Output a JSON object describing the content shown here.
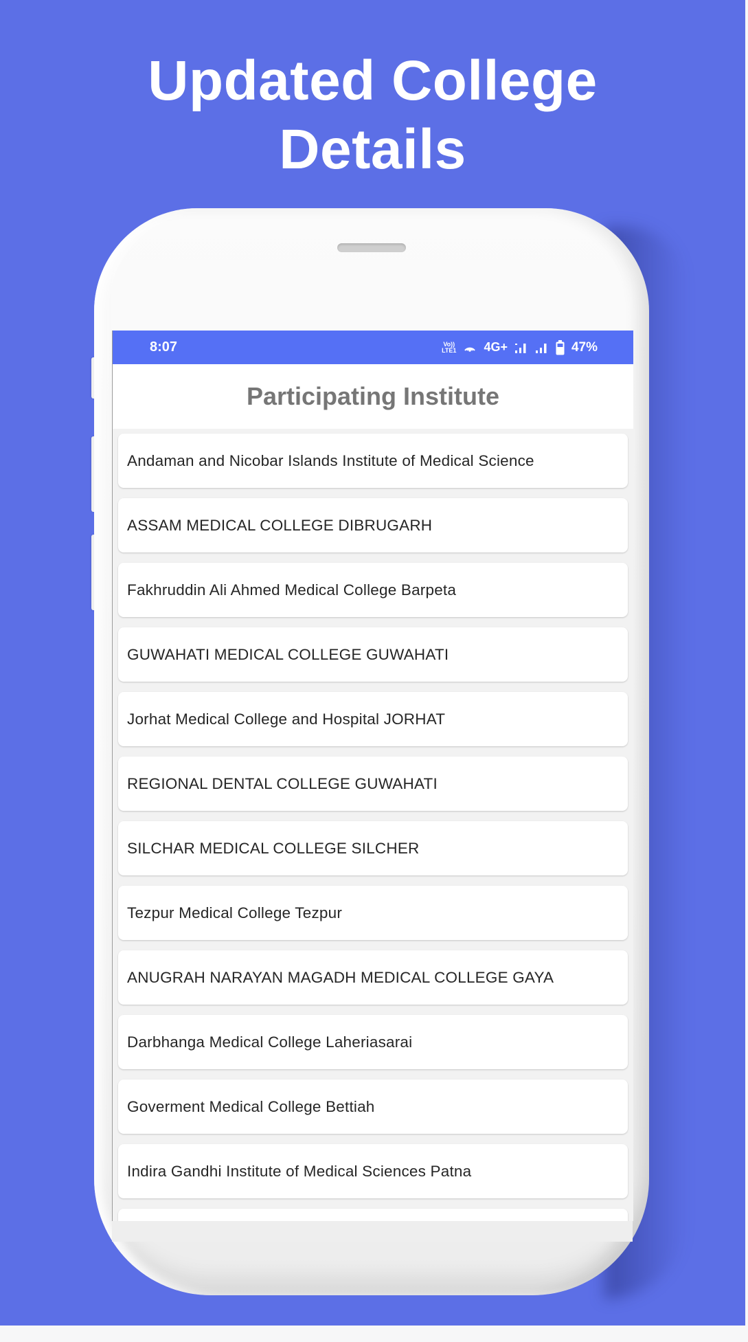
{
  "promo": {
    "headline_line1": "Updated College",
    "headline_line2": "Details",
    "background_color": "#5c6fe6"
  },
  "status_bar": {
    "time": "8:07",
    "volte_label_top": "Vo))",
    "volte_label_bottom": "LTE1",
    "network_type": "4G+",
    "battery_percent": "47%",
    "icons": [
      "volte-icon",
      "hotspot-icon",
      "signal-bars-icon",
      "signal-bars-icon",
      "battery-icon"
    ],
    "color": "#5570f5"
  },
  "app": {
    "title": "Participating Institute",
    "institutes": [
      "Andaman and Nicobar Islands Institute of Medical Science",
      "ASSAM MEDICAL COLLEGE DIBRUGARH",
      "Fakhruddin Ali Ahmed Medical College Barpeta",
      "GUWAHATI MEDICAL COLLEGE GUWAHATI",
      "Jorhat Medical College and Hospital JORHAT",
      "REGIONAL DENTAL COLLEGE GUWAHATI",
      "SILCHAR MEDICAL COLLEGE SILCHER",
      "Tezpur Medical College Tezpur",
      "ANUGRAH NARAYAN MAGADH MEDICAL COLLEGE GAYA",
      "Darbhanga Medical College Laheriasarai",
      "Goverment Medical College Bettiah",
      "Indira Gandhi Institute of Medical Sciences Patna",
      ""
    ]
  }
}
